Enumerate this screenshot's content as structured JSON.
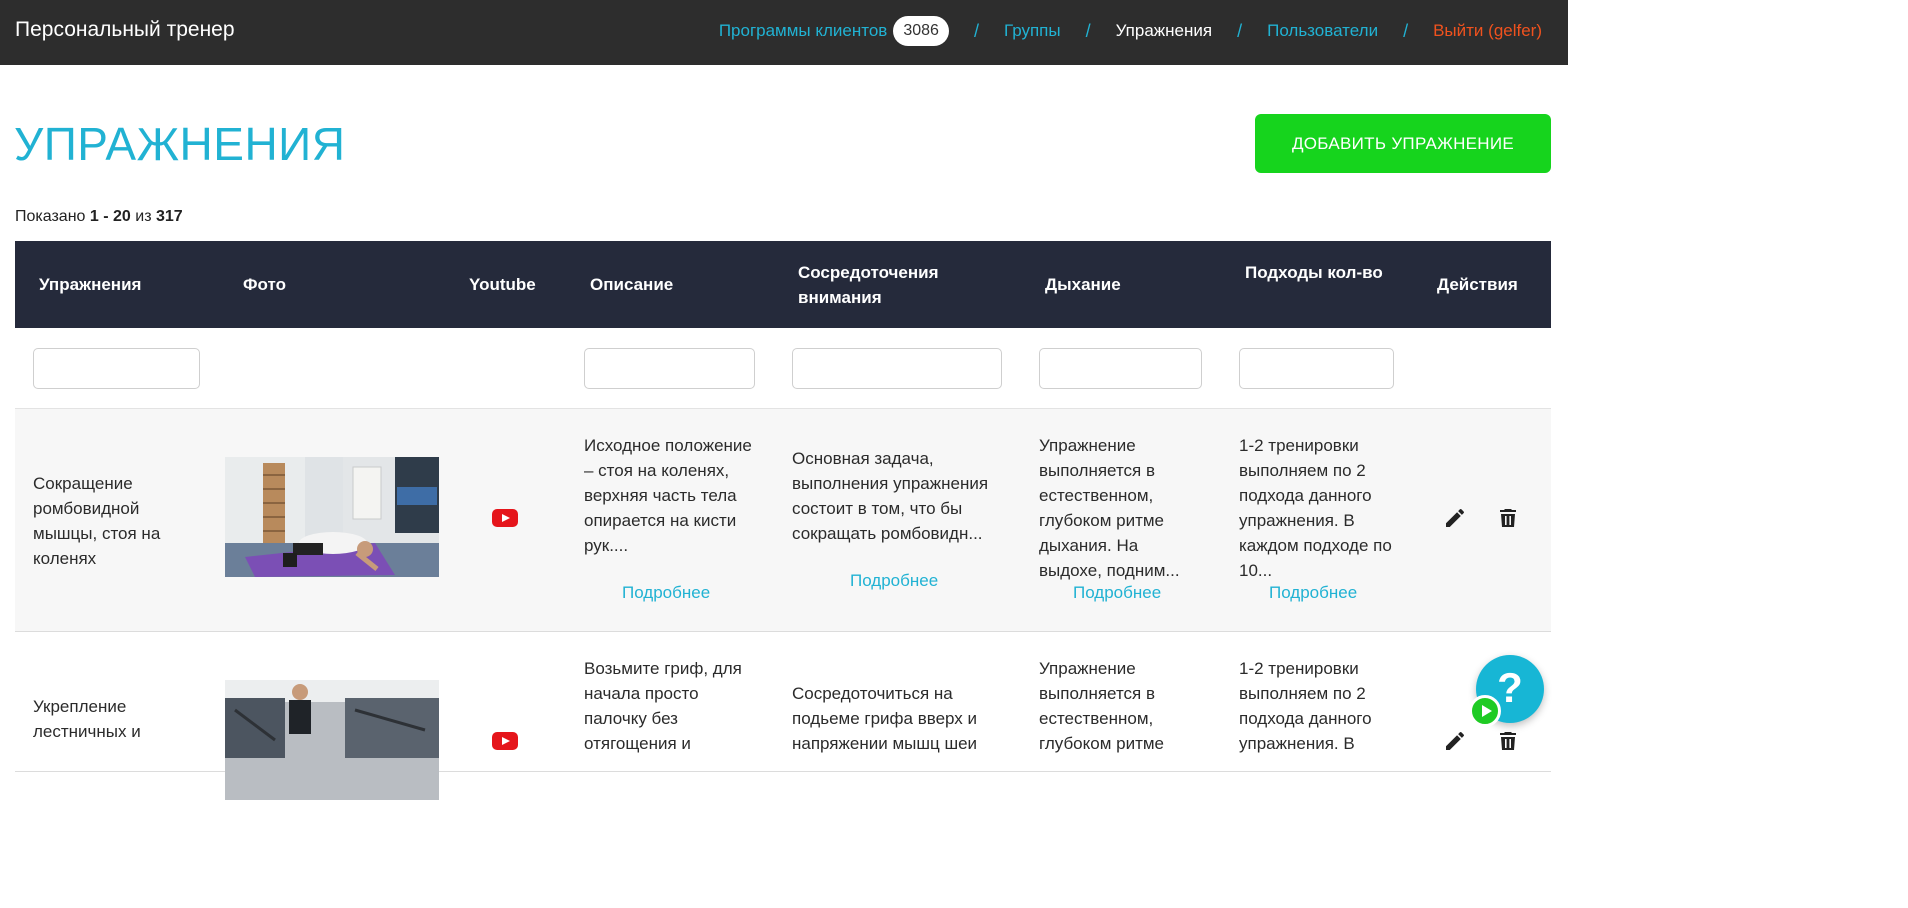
{
  "header": {
    "brand": "Персональный тренер",
    "nav": {
      "programs_label": "Программы клиентов",
      "programs_count": "3086",
      "groups_label": "Группы",
      "exercises_label": "Упражнения",
      "users_label": "Пользователи",
      "logout_label": "Выйти (gelfer)",
      "separator": "/"
    }
  },
  "page": {
    "title": "УПРАЖНЕНИЯ",
    "add_button": "ДОБАВИТЬ УПРАЖНЕНИЕ",
    "shown_prefix": "Показано",
    "shown_range": "1 - 20",
    "shown_of": "из",
    "shown_total": "317"
  },
  "table": {
    "columns": {
      "exercise": "Упражнения",
      "photo": "Фото",
      "youtube": "Youtube",
      "description": "Описание",
      "focus": "Сосредоточения внимания",
      "breathing": "Дыхание",
      "sets": "Подходы кол-во",
      "actions": "Действия"
    },
    "more_label": "Подробнее",
    "rows": [
      {
        "name": "Сокращение ромбовидной мышцы, стоя на коленях",
        "description": "Исходное положение – стоя на коленях, верхняя часть тела опирается на кисти рук....",
        "focus": "Основная задача, выполнения упражнения состоит в том, что бы сокращать ромбовидн...",
        "breathing": "Упражнение выполняется в естественном, глубоком ритме дыхания. На выдохе, подним...",
        "sets": "1-2 тренировки выполняем по 2 подхода данного упражнения. В каждом подходе по 10..."
      },
      {
        "name": "Укрепление лестничных и",
        "description": "Возьмите гриф, для начала просто палочку без отягощения и",
        "focus": "Сосредоточиться на подьеме грифа вверх и напряжении мышц шеи",
        "breathing": "Упражнение выполняется в естественном, глубоком ритме",
        "sets": "1-2 тренировки выполняем по 2 подхода данного упражнения. В"
      }
    ]
  },
  "help": {
    "symbol": "?"
  },
  "icons": {
    "edit": "pencil-icon",
    "delete": "trash-icon",
    "youtube": "youtube-icon",
    "help": "help-icon",
    "play": "play-icon"
  },
  "colors": {
    "accent": "#21b2d3",
    "topbar": "#2d2d2d",
    "table_header": "#252a3b",
    "add_button": "#16d41d",
    "logout": "#f0521e",
    "youtube": "#e5151b"
  }
}
